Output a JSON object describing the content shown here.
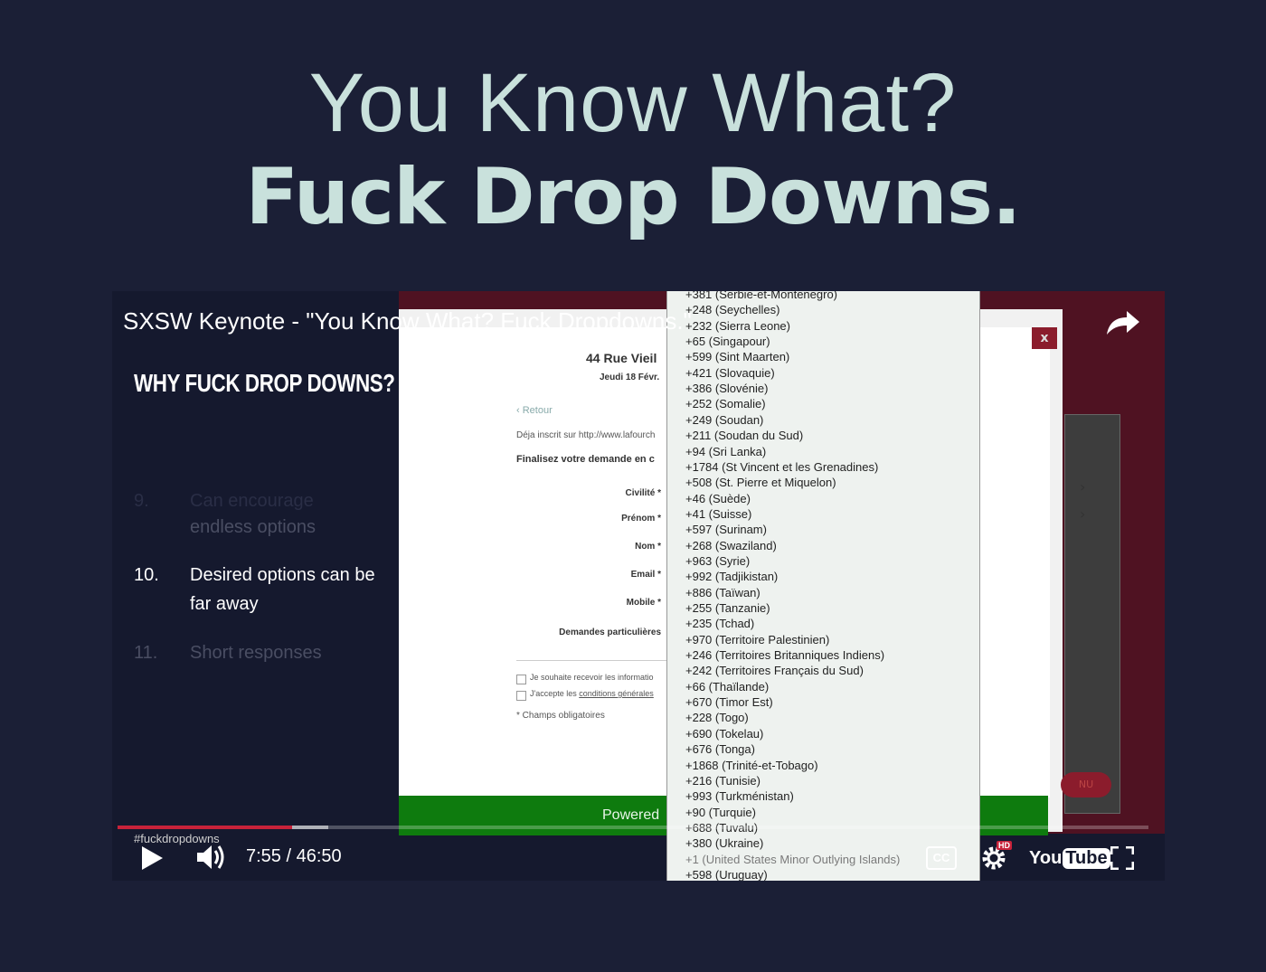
{
  "headline": {
    "line1": "You Know What?",
    "line2": "Fuck Drop Downs."
  },
  "slide": {
    "title": "WHY FUCK DROP DOWNS?",
    "items": [
      {
        "num": "9.",
        "text": "Can encourage"
      },
      {
        "num": "",
        "text": "endless options"
      },
      {
        "num": "10.",
        "text": "Desired options can be far away"
      },
      {
        "num": "11.",
        "text": "Short responses"
      }
    ]
  },
  "video": {
    "title": "SXSW Keynote - \"You Know What? Fuck Dropdowns.\"",
    "hashtag": "#fuckdropdowns",
    "time": "7:55 / 46:50",
    "progress_fraction": 0.169,
    "buffered_fraction": 0.204,
    "cc_label": "CC",
    "hd_badge": "HD",
    "logo_you": "You",
    "logo_tube": "Tube"
  },
  "form": {
    "address": "44 Rue Vieil",
    "date": "Jeudi 18 Févr.",
    "back": "Retour",
    "registered": "Déja inscrit sur http://www.lafourch",
    "finalize": "Finalisez votre demande en c",
    "labels": [
      "Civilité *",
      "Prénom *",
      "Nom *",
      "Email *",
      "Mobile *",
      "Demandes particulières"
    ],
    "checkbox1": "Je souhaite recevoir les informatio",
    "checkbox2_prefix": "J'accepte les ",
    "checkbox2_link": "conditions générales",
    "required": "* Champs obligatoires",
    "powered": "Powered",
    "close": "x",
    "menu_btn": "NU"
  },
  "dropdown": {
    "options": [
      "+381 (Serbie-et-Montenegro)",
      "+248 (Seychelles)",
      "+232 (Sierra Leone)",
      "+65 (Singapour)",
      "+599 (Sint Maarten)",
      "+421 (Slovaquie)",
      "+386 (Slovénie)",
      "+252 (Somalie)",
      "+249 (Soudan)",
      "+211 (Soudan du Sud)",
      "+94 (Sri Lanka)",
      "+1784 (St Vincent et les Grenadines)",
      "+508 (St. Pierre et Miquelon)",
      "+46 (Suède)",
      "+41 (Suisse)",
      "+597 (Surinam)",
      "+268 (Swaziland)",
      "+963 (Syrie)",
      "+992 (Tadjikistan)",
      "+886 (Taïwan)",
      "+255 (Tanzanie)",
      "+235 (Tchad)",
      "+970 (Territoire Palestinien)",
      "+246 (Territoires Britanniques Indiens)",
      "+242 (Territoires Français du Sud)",
      "+66 (Thaïlande)",
      "+670 (Timor Est)",
      "+228 (Togo)",
      "+690 (Tokelau)",
      "+676 (Tonga)",
      "+1868 (Trinité-et-Tobago)",
      "+216 (Tunisie)",
      "+993 (Turkménistan)",
      "+90 (Turquie)",
      "+688 (Tuvalu)",
      "+380 (Ukraine)",
      "+1 (United States Minor Outlying Islands)",
      "+598 (Uruguay)"
    ],
    "highlighted_index": 36
  }
}
